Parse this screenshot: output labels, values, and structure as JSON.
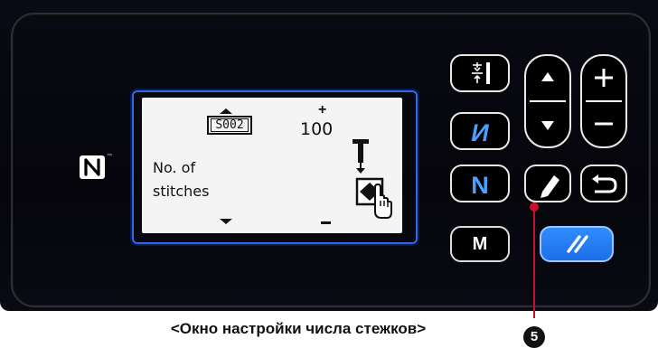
{
  "screen": {
    "pattern_id": "S002",
    "label_line1": "No. of",
    "label_line2": "stitches",
    "value": "100",
    "value_plus": "+"
  },
  "buttons": {
    "mode": "M"
  },
  "callout": {
    "number": "5"
  },
  "caption": "<Окно настройки числа стежков>",
  "icons": {
    "nfc": "nfc-icon",
    "thread_trim": "thread-trim-icon",
    "reverse_n": "reverse-n-icon",
    "n": "n-icon",
    "up": "up-arrow-icon",
    "down": "down-arrow-icon",
    "plus": "plus-icon",
    "minus": "minus-icon",
    "edit": "pencil-icon",
    "back": "return-icon",
    "reset": "reset-icon"
  },
  "colors": {
    "panel": "#05050b",
    "lcd_frame": "#2f6be0",
    "reset_button": "#1d6fe6",
    "callout": "#c8102e"
  }
}
